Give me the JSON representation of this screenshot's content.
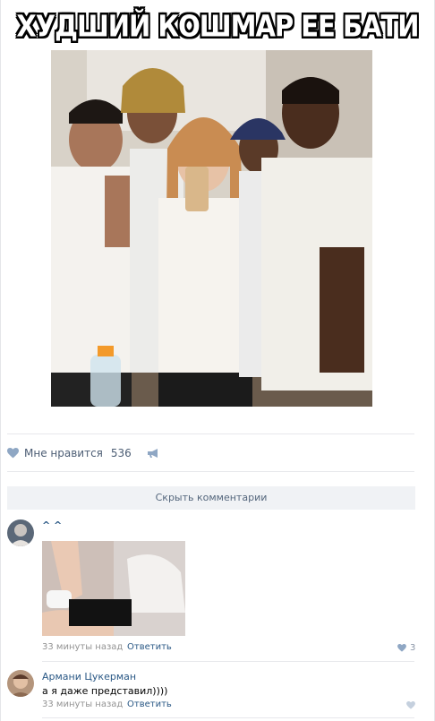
{
  "post": {
    "meme_caption": "ХУДШИЙ КОШМАР ЕЕ БАТИ",
    "likes_label": "Мне нравится",
    "likes_count": "536"
  },
  "comments_toggle": {
    "label": "Скрыть комментарии"
  },
  "comments": [
    {
      "author": "^ ^",
      "text": "",
      "time": "33 минуты назад",
      "reply_label": "Ответить",
      "likes": "3",
      "has_image": true
    },
    {
      "author": "Армани Цукерман",
      "text": "а я даже представил))))",
      "time": "33 минуты назад",
      "reply_label": "Ответить",
      "likes": ""
    }
  ],
  "colors": {
    "link": "#2a5885",
    "muted": "#939393",
    "like_icon": "#8fa7c4",
    "divider": "#e7e8ec",
    "toggle_bg": "#f0f2f5"
  },
  "icons": {
    "like": "heart-icon",
    "share": "megaphone-share-icon"
  }
}
